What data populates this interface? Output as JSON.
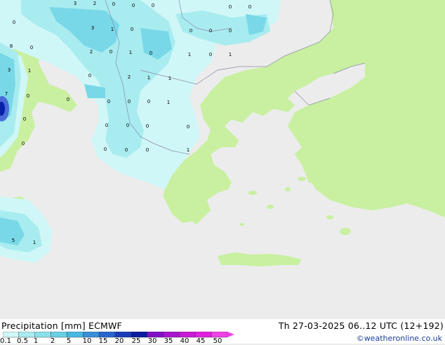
{
  "map": {
    "colors": {
      "sea": "#ececec",
      "land_dry": "#c8f0a0",
      "precip_light": "#d0f7f7",
      "precip_low": "#a8ecf0",
      "precip_mid": "#78d8e8",
      "precip_high": "#4a6cd8",
      "precip_max": "#0820a8",
      "borders": "#8a8aa8"
    },
    "point_values": [
      "3",
      "2",
      "0",
      "0",
      "0",
      "0",
      "0",
      "0",
      "3",
      "1",
      "0",
      "0",
      "0",
      "0",
      "8",
      "0",
      "2",
      "0",
      "1",
      "0",
      "1",
      "0",
      "1",
      "3",
      "1",
      "0",
      "2",
      "1",
      "1",
      "7",
      "0",
      "0",
      "0",
      "0",
      "0",
      "1",
      "0",
      "0",
      "0",
      "0",
      "0",
      "0",
      "0",
      "0",
      "0",
      "1",
      "5",
      "1"
    ]
  },
  "footer": {
    "title": "Precipitation [mm]  ECMWF",
    "datetime": "Th 27-03-2025 06..12 UTC (12+192)",
    "credit": "©weatheronline.co.uk",
    "scale_labels": [
      "0.1",
      "0.5",
      "1",
      "2",
      "5",
      "10",
      "15",
      "20",
      "25",
      "30",
      "35",
      "40",
      "45",
      "50"
    ],
    "scale_colors": [
      "#d0f7f7",
      "#a8ecf0",
      "#8ae0ea",
      "#68d0e4",
      "#48b8e0",
      "#3a8ed8",
      "#2a64cc",
      "#1a3cb8",
      "#0a1ca0",
      "#8010c8",
      "#a814d0",
      "#c818d8",
      "#e020e0",
      "#f040e8"
    ]
  }
}
